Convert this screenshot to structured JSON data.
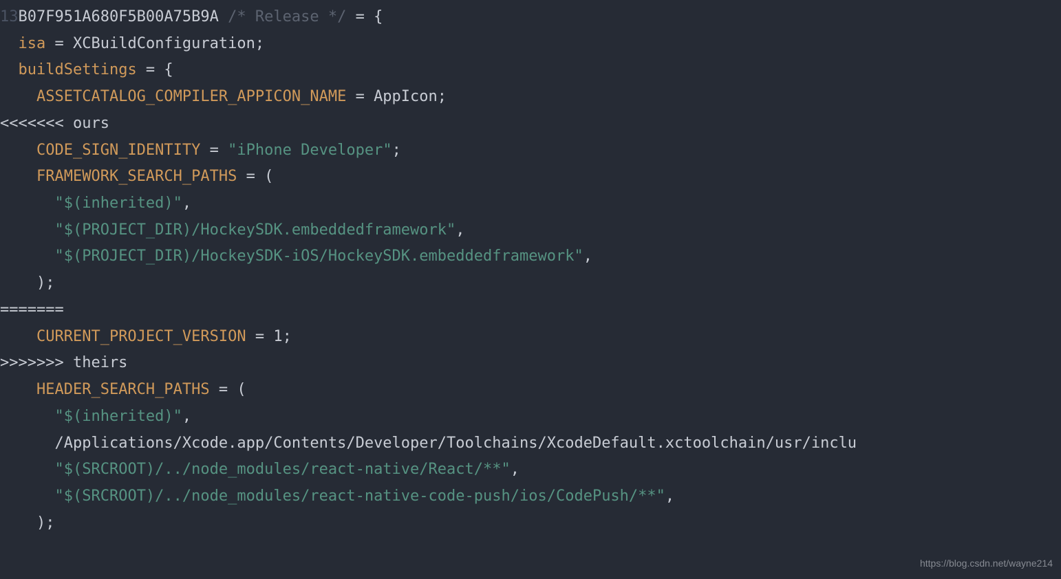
{
  "line_number": "13",
  "hex_id": "B07F951A680F5B00A75B9A",
  "comment": "/* Release */",
  "eq_open": " = {",
  "indent1": "  ",
  "indent2": "    ",
  "indent3": "      ",
  "isa_key": "isa",
  "isa_val": " = XCBuildConfiguration;",
  "bs_key": "buildSettings",
  "bs_val": " = {",
  "asset_key": "ASSETCATALOG_COMPILER_APPICON_NAME",
  "asset_val": " = AppIcon;",
  "conflict_ours": "<<<<<<< ours",
  "csi_key": "CODE_SIGN_IDENTITY",
  "csi_eq": " = ",
  "csi_str": "\"iPhone Developer\"",
  "semi": ";",
  "fsp_key": "FRAMEWORK_SEARCH_PATHS",
  "fsp_eq": " = (",
  "inh_str": "\"$(inherited)\"",
  "comma": ",",
  "hockey1": "\"$(PROJECT_DIR)/HockeySDK.embeddedframework\"",
  "hockey2": "\"$(PROJECT_DIR)/HockeySDK-iOS/HockeySDK.embeddedframework\"",
  "close_paren": ");",
  "conflict_sep": "=======",
  "cpv_key": "CURRENT_PROJECT_VERSION",
  "cpv_val": " = 1;",
  "conflict_theirs": ">>>>>>> theirs",
  "hsp_key": "HEADER_SEARCH_PATHS",
  "hsp_eq": " = (",
  "xcode_path": "/Applications/Xcode.app/Contents/Developer/Toolchains/XcodeDefault.xctoolchain/usr/inclu",
  "src1": "\"$(SRCROOT)/../node_modules/react-native/React/**\"",
  "src2": "\"$(SRCROOT)/../node_modules/react-native-code-push/ios/CodePush/**\"",
  "watermark": "https://blog.csdn.net/wayne214"
}
